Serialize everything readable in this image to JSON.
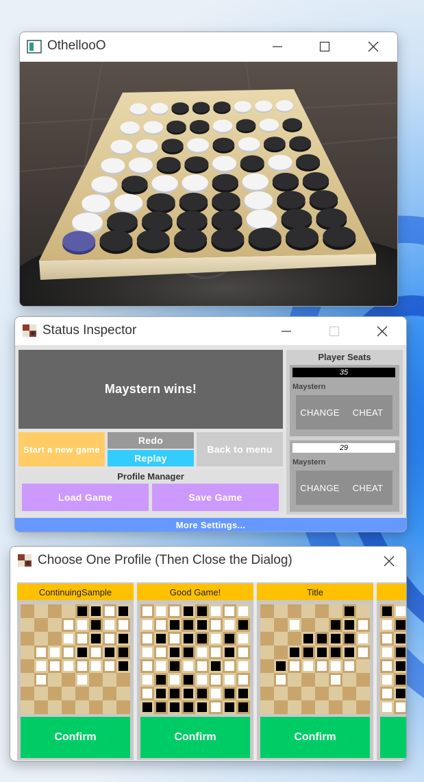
{
  "othello_window": {
    "title": "OthellooO",
    "board_rows": [
      "WWBBBWWW",
      "WWBBWBWB",
      "WWBWBWBB",
      "WWBBWBWB",
      "WBWWBWBB",
      "WWBBBWBB",
      "WBBBBWBB",
      "SBBBBBBB"
    ]
  },
  "status_window": {
    "title": "Status Inspector",
    "message": "Maystern wins!",
    "start_new_game": "Start a new game",
    "redo": "Redo",
    "replay": "Replay",
    "back_to_menu": "Back to menu",
    "profile_manager": {
      "heading": "Profile Manager",
      "load": "Load Game",
      "save": "Save Game"
    },
    "player_seats": {
      "heading": "Player Seats",
      "seats": [
        {
          "score": "35",
          "name": "Maystern",
          "change": "CHANGE",
          "cheat": "CHEAT",
          "color": "black"
        },
        {
          "score": "29",
          "name": "Maystern",
          "change": "CHANGE",
          "cheat": "CHEAT",
          "color": "white"
        }
      ]
    },
    "more_settings": "More Settings..."
  },
  "profile_window": {
    "title": "Choose One Profile (Then Close the Dialog)",
    "profiles": [
      {
        "name": "ContinuingSample",
        "confirm": "Confirm",
        "board": [
          "....BBWB",
          "...WWBWW",
          "...WWBWB",
          ".WWWBWBB",
          ".WWWWWWB",
          ".W..W...",
          "........",
          "........"
        ]
      },
      {
        "name": "Good Game!",
        "confirm": "Confirm",
        "board": [
          "WWWBBWWW",
          "WWBBBWWB",
          "WBWBBWBW",
          "WWBBWWBW",
          "WWBWWBWW",
          "WBWBWWWW",
          "WBBBBWBB",
          "BBBBBWBB"
        ]
      },
      {
        "name": "Title",
        "confirm": "Confirm",
        "board": [
          "......B.",
          "..W..BBW",
          "...BBBBW",
          "..BBBBBW",
          ".BWWWWW.",
          ".W...W..",
          "........",
          "........"
        ]
      },
      {
        "name": "",
        "confirm": "",
        "board": [
          "BW......",
          "WB......",
          "WB......",
          "WB......",
          "WB......",
          "WB......",
          "WB......",
          "WW......"
        ]
      }
    ]
  },
  "colors": {
    "status_gray": "#666666",
    "start_orange": "#ffcc66",
    "redo_gray": "#999999",
    "replay_cyan": "#33ccff",
    "back_gray": "#cccccc",
    "profile_purple": "#cc99ff",
    "more_settings_blue": "#6699ff",
    "confirm_green": "#00cc66",
    "card_title_yellow": "#ffc000"
  }
}
